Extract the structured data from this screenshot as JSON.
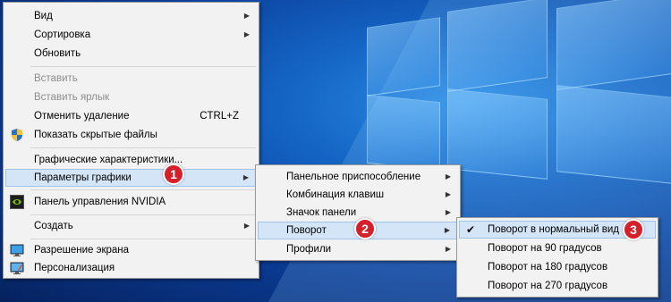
{
  "menu_main": {
    "items": [
      {
        "label": "Вид"
      },
      {
        "label": "Сортировка"
      },
      {
        "label": "Обновить"
      },
      {
        "label": "Вставить"
      },
      {
        "label": "Вставить ярлык"
      },
      {
        "label": "Отменить удаление",
        "shortcut": "CTRL+Z"
      },
      {
        "label": "Показать скрытые файлы"
      },
      {
        "label": "Графические характеристики..."
      },
      {
        "label": "Параметры графики"
      },
      {
        "label": "Панель управления NVIDIA"
      },
      {
        "label": "Создать"
      },
      {
        "label": "Разрешение экрана"
      },
      {
        "label": "Персонализация"
      }
    ]
  },
  "menu_graphics": {
    "items": [
      {
        "label": "Панельное приспособление"
      },
      {
        "label": "Комбинация клавиш"
      },
      {
        "label": "Значок панели"
      },
      {
        "label": "Поворот"
      },
      {
        "label": "Профили"
      }
    ]
  },
  "menu_rotation": {
    "items": [
      {
        "label": "Поворот в нормальный вид",
        "checked": true
      },
      {
        "label": "Поворот на 90 градусов"
      },
      {
        "label": "Поворот на 180 градусов"
      },
      {
        "label": "Поворот на 270 градусов"
      }
    ]
  },
  "badges": [
    "1",
    "2",
    "3"
  ],
  "colors": {
    "highlight": "#d4e5f7",
    "badge": "#d51f2a",
    "menu_bg": "#f2f2f2"
  },
  "icons": {
    "shield": "uac-shield-icon",
    "nvidia": "nvidia-icon",
    "display": "display-icon",
    "personalize": "personalize-icon"
  }
}
